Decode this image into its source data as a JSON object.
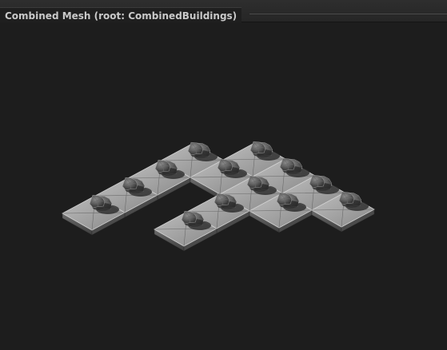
{
  "window": {
    "title": "Combined Mesh (root: CombinedBuildings)"
  },
  "viewport": {
    "icon": "mesh-preview",
    "background_color": "#1d1d1d"
  }
}
